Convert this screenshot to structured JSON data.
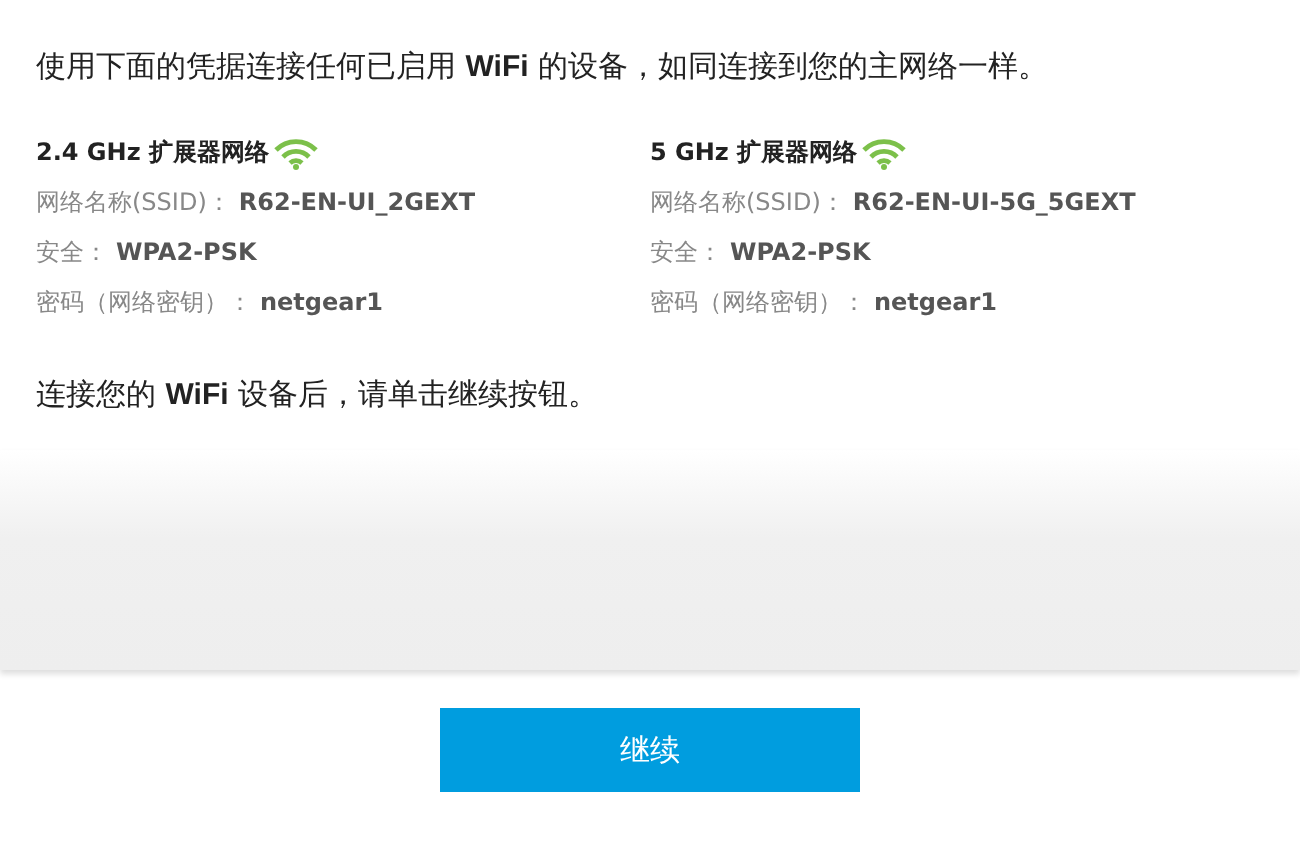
{
  "intro": "使用下面的凭据连接任何已启用 **WiFi** 的设备，如同连接到您的主网络一样。",
  "networks": [
    {
      "title": "2.4 GHz 扩展器网络",
      "fields": [
        {
          "label": "网络名称(SSID)：",
          "value": "R62-EN-UI_2GEXT"
        },
        {
          "label": "安全：",
          "value": "WPA2-PSK"
        },
        {
          "label": "密码（网络密钥）：",
          "value": "netgear1"
        }
      ]
    },
    {
      "title": "5 GHz 扩展器网络",
      "fields": [
        {
          "label": "网络名称(SSID)：",
          "value": "R62-EN-UI-5G_5GEXT"
        },
        {
          "label": "安全：",
          "value": "WPA2-PSK"
        },
        {
          "label": "密码（网络密钥）：",
          "value": "netgear1"
        }
      ]
    }
  ],
  "note": "连接您的 **WiFi** 设备后，请单击继续按钮。",
  "button": "继续"
}
